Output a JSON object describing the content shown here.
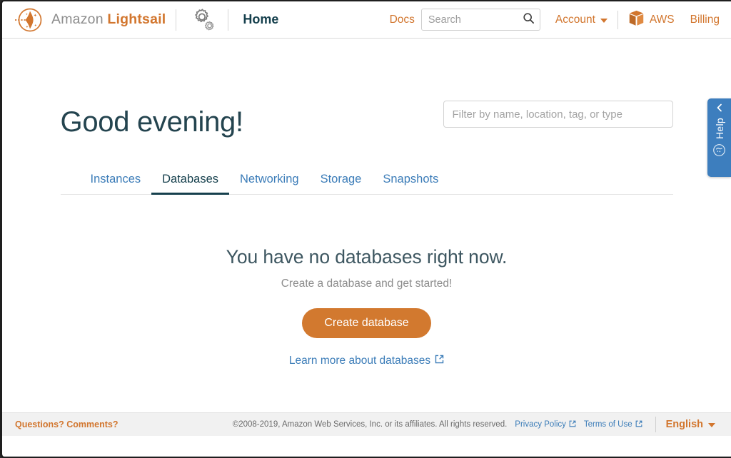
{
  "header": {
    "logo_icon": "lightsail-logo-icon",
    "brand_amazon": "Amazon",
    "brand_lightsail": "Lightsail",
    "gear_icon": "gears-icon",
    "home_label": "Home",
    "docs_label": "Docs",
    "search": {
      "placeholder": "Search",
      "value": "",
      "icon": "search-icon"
    },
    "account_label": "Account",
    "account_caret_icon": "chevron-down-icon",
    "aws_label": "AWS",
    "aws_icon": "aws-cube-icon",
    "billing_label": "Billing"
  },
  "main": {
    "greeting": "Good evening!",
    "filter": {
      "placeholder": "Filter by name, location, tag, or type",
      "value": ""
    },
    "tabs": [
      {
        "label": "Instances",
        "active": false
      },
      {
        "label": "Databases",
        "active": true
      },
      {
        "label": "Networking",
        "active": false
      },
      {
        "label": "Storage",
        "active": false
      },
      {
        "label": "Snapshots",
        "active": false
      }
    ],
    "empty_state": {
      "title": "You have no databases right now.",
      "subtitle": "Create a database and get started!",
      "button_label": "Create database",
      "learn_more_label": "Learn more about databases",
      "learn_more_icon": "external-link-icon"
    }
  },
  "help_tab": {
    "chevron_icon": "chevron-left-icon",
    "label": "Help",
    "bubble_icon": "chat-bubble-icon"
  },
  "footer": {
    "questions_label": "Questions? Comments?",
    "copyright": "©2008-2019, Amazon Web Services, Inc. or its affiliates. All rights reserved.",
    "privacy_label": "Privacy Policy",
    "privacy_icon": "external-link-icon",
    "terms_label": "Terms of Use",
    "terms_icon": "external-link-icon",
    "language_label": "English",
    "language_caret_icon": "chevron-down-icon"
  },
  "colors": {
    "accent_orange": "#d2762e",
    "button_orange": "#d2792f",
    "link_blue": "#3b7cb8",
    "help_blue": "#3d7ebe",
    "dark_navy": "#16404d",
    "footer_bg": "#f1f1f1"
  }
}
